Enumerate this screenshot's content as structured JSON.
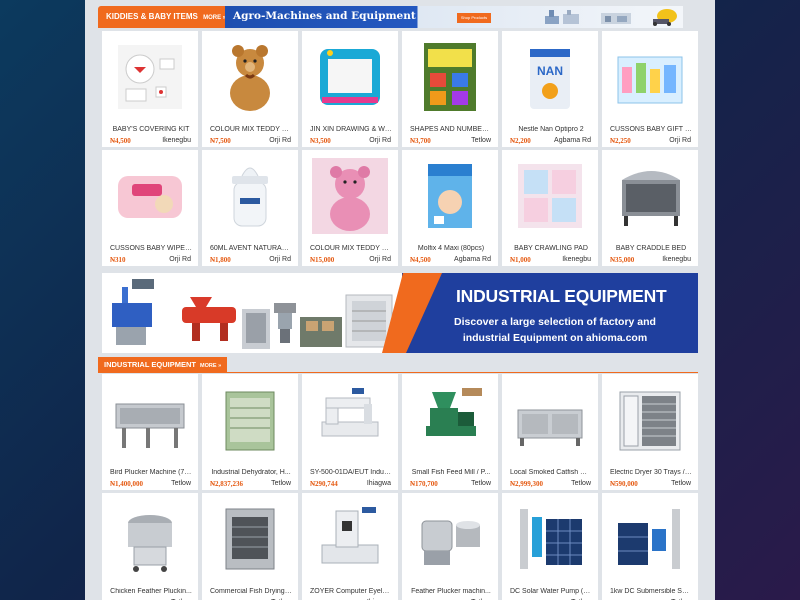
{
  "kiddies_section": {
    "tab_label": "KIDDIES & BABY ITEMS",
    "more_label": "MORE »"
  },
  "agro_banner": {
    "title": "Agro-Machines and Equipment",
    "button_label": "Shop Products"
  },
  "kiddies_products": [
    {
      "name": "BABY'S COVERING KIT",
      "price": "₦4,500",
      "location": "Ikenegbu",
      "icon": "baby-kit-icon"
    },
    {
      "name": "COLOUR MIX TEDDY BE...",
      "price": "₦7,500",
      "location": "Orji Rd",
      "icon": "teddy-bear-icon"
    },
    {
      "name": "JIN XIN DRAWING & WRI...",
      "price": "₦3,500",
      "location": "Orji Rd",
      "icon": "drawing-board-icon"
    },
    {
      "name": "SHAPES AND NUMBERI...",
      "price": "₦3,700",
      "location": "Tetlow",
      "icon": "book-icon"
    },
    {
      "name": "Nestle Nan Optipro 2",
      "price": "₦2,200",
      "location": "Agbama Rd",
      "icon": "formula-can-icon"
    },
    {
      "name": "CUSSONS BABY GIFT PA...",
      "price": "₦2,250",
      "location": "Orji Rd",
      "icon": "gift-pack-icon"
    },
    {
      "name": "CUSSONS BABY WIPES ...",
      "price": "₦310",
      "location": "Orji Rd",
      "icon": "wipes-icon"
    },
    {
      "name": "60ML AVENT NATURAL ...",
      "price": "₦1,800",
      "location": "Orji Rd",
      "icon": "baby-bottle-icon"
    },
    {
      "name": "COLOUR MIX TEDDY BE...",
      "price": "₦15,000",
      "location": "Orji Rd",
      "icon": "pink-teddy-icon"
    },
    {
      "name": "Molfix 4 Maxi (80pcs)",
      "price": "₦4,500",
      "location": "Agbama Rd",
      "icon": "diaper-pack-icon"
    },
    {
      "name": "BABY CRAWLING PAD",
      "price": "₦1,000",
      "location": "Ikenegbu",
      "icon": "crawling-pad-icon"
    },
    {
      "name": "BABY CRADDLE BED",
      "price": "₦35,000",
      "location": "Ikenegbu",
      "icon": "cradle-bed-icon"
    }
  ],
  "industrial_banner": {
    "headline": "INDUSTRIAL EQUIPMENT",
    "subline": "Discover a large selection of factory and industrial Equipment on ahioma.com"
  },
  "industrial_section": {
    "tab_label": "INDUSTRIAL EQUIPMENT",
    "more_label": "MORE »"
  },
  "industrial_products": [
    {
      "name": "Bird Plucker Machine (7 ...",
      "price": "₦1,400,000",
      "location": "Tetlow",
      "icon": "plucker-machine-icon"
    },
    {
      "name": "Industrial Dehydrator, H...",
      "price": "₦2,837,236",
      "location": "Tetlow",
      "icon": "dehydrator-icon"
    },
    {
      "name": "SY-500-01DA/EUT Indus...",
      "price": "₦290,744",
      "location": "Ihiagwa",
      "icon": "sewing-machine-icon"
    },
    {
      "name": "Small Fish Feed Mill / P...",
      "price": "₦170,700",
      "location": "Tetlow",
      "icon": "feed-mill-icon"
    },
    {
      "name": "Local Smoked Catfish Dr...",
      "price": "₦2,999,300",
      "location": "Tetlow",
      "icon": "catfish-dryer-icon"
    },
    {
      "name": "Electric Dryer 30 Trays / ...",
      "price": "₦590,000",
      "location": "Tetlow",
      "icon": "electric-dryer-icon"
    },
    {
      "name": "Chicken Feather Pluckin...",
      "price": "₦400,000",
      "location": "Tetlow",
      "icon": "feather-plucker-icon"
    },
    {
      "name": "Commercial Fish Drying ...",
      "price": "₦580,900",
      "location": "Tetlow",
      "icon": "fish-drying-oven-icon"
    },
    {
      "name": "ZOYER Computer Eyelet ...",
      "price": "₦456,212.60",
      "location": "Ihiagwa",
      "icon": "eyelet-machine-icon"
    },
    {
      "name": "Feather Plucker machin...",
      "price": "₦500,000",
      "location": "Tetlow",
      "icon": "plucker-drum-icon"
    },
    {
      "name": "DC Solar Water Pump (S...",
      "price": "₦119,000",
      "location": "Tetlow",
      "icon": "solar-pump-icon"
    },
    {
      "name": "1kw DC Submersible Sol...",
      "price": "₦76,000",
      "location": "Tetlow",
      "icon": "submersible-pump-icon"
    }
  ]
}
